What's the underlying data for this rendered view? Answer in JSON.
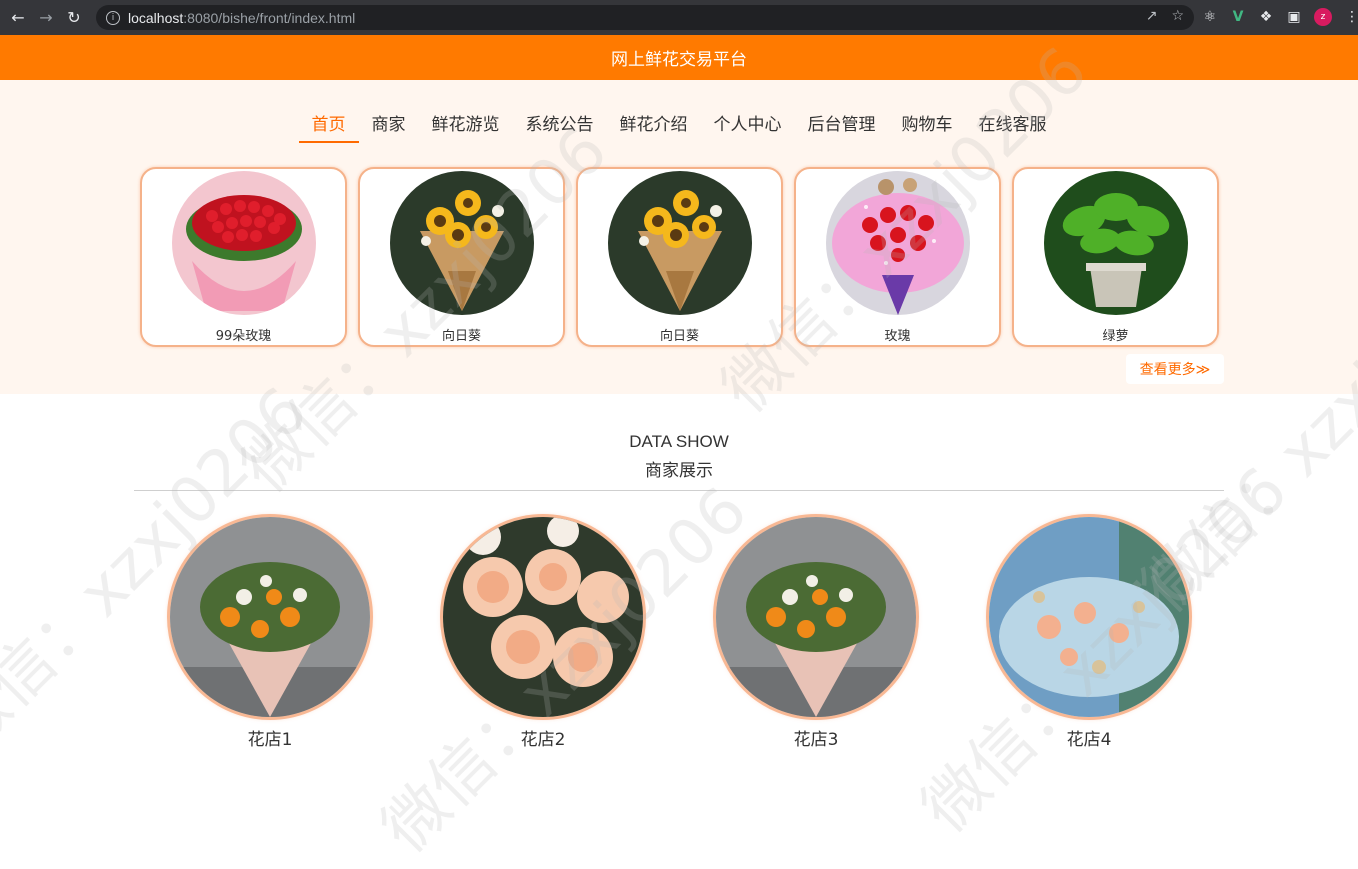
{
  "browser": {
    "url_host": "localhost",
    "url_rest": ":8080/bishe/front/index.html",
    "avatar_letter": "z"
  },
  "header": {
    "title": "网上鲜花交易平台"
  },
  "nav": {
    "items": [
      {
        "label": "首页",
        "active": true
      },
      {
        "label": "商家"
      },
      {
        "label": "鲜花游览"
      },
      {
        "label": "系统公告"
      },
      {
        "label": "鲜花介绍"
      },
      {
        "label": "个人中心"
      },
      {
        "label": "后台管理"
      },
      {
        "label": "购物车"
      },
      {
        "label": "在线客服"
      }
    ]
  },
  "flowers": [
    {
      "name": "99朵玫瑰",
      "image": "red-rose-bouquet"
    },
    {
      "name": "向日葵",
      "image": "sunflower-bouquet"
    },
    {
      "name": "向日葵",
      "image": "sunflower-bouquet"
    },
    {
      "name": "玫瑰",
      "image": "rose-bouquet-pink"
    },
    {
      "name": "绿萝",
      "image": "pothos-plant"
    }
  ],
  "more_label": "查看更多≫",
  "data_show": {
    "title_en": "DATA SHOW",
    "title_cn": "商家展示"
  },
  "shops": [
    {
      "name": "花店1",
      "image": "orange-bouquet"
    },
    {
      "name": "花店2",
      "image": "peach-roses"
    },
    {
      "name": "花店3",
      "image": "orange-bouquet"
    },
    {
      "name": "花店4",
      "image": "blue-peach-bouquet"
    }
  ],
  "colors": {
    "accent": "#ff7a00",
    "nav_active": "#ff6a00",
    "card_border": "#f5b28a",
    "section_bg": "#fff6ef"
  },
  "watermark": "微信：xzxj0206"
}
